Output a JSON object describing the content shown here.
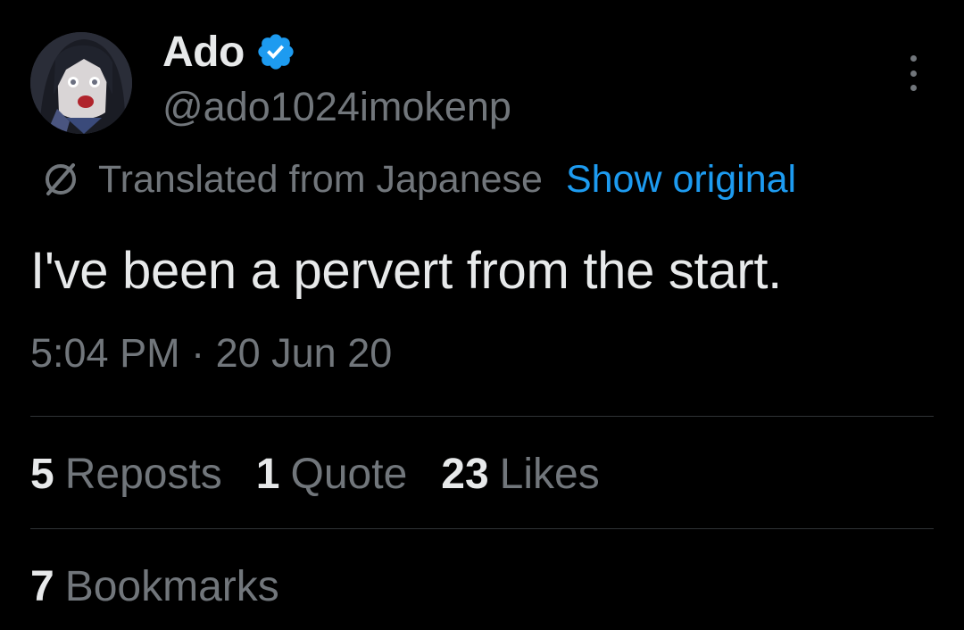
{
  "author": {
    "display_name": "Ado",
    "handle": "@ado1024imokenp",
    "verified": true,
    "avatar_icon": "avatar-image"
  },
  "translation": {
    "label": "Translated from Japanese",
    "show_original_label": "Show original"
  },
  "tweet": {
    "text": "I've been a pervert from the start.",
    "timestamp": "5:04 PM · 20 Jun 20"
  },
  "stats": {
    "reposts": {
      "count": "5",
      "label": "Reposts"
    },
    "quotes": {
      "count": "1",
      "label": "Quote"
    },
    "likes": {
      "count": "23",
      "label": "Likes"
    },
    "bookmarks": {
      "count": "7",
      "label": "Bookmarks"
    }
  },
  "colors": {
    "background": "#000000",
    "text_primary": "#e7e9ea",
    "text_secondary": "#71767b",
    "accent": "#1d9bf0",
    "divider": "#2f3336"
  }
}
